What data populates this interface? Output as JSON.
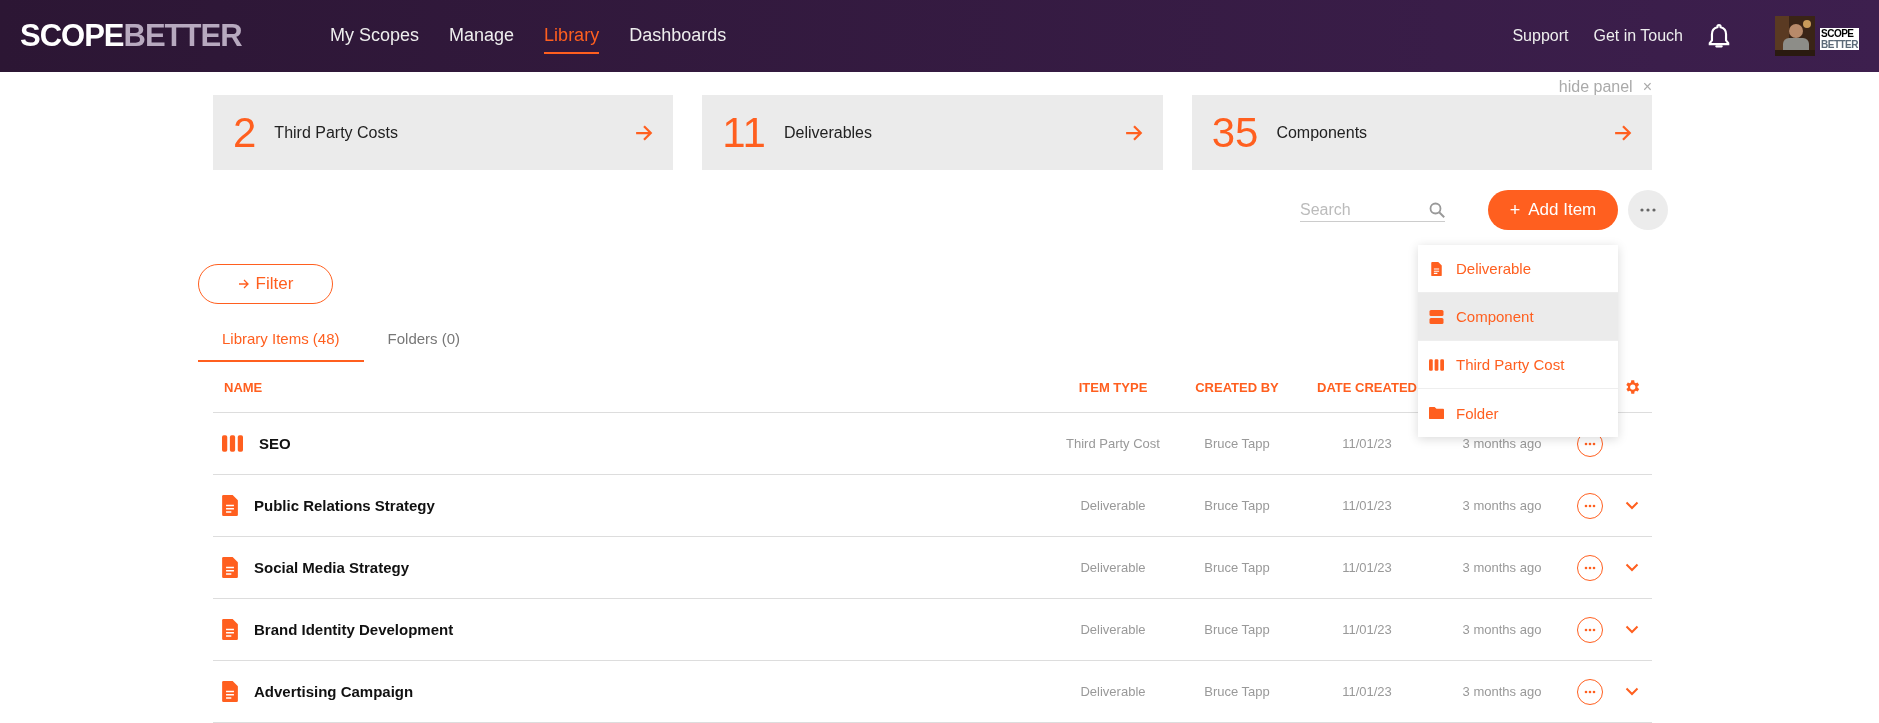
{
  "nav": {
    "logo": [
      "SCOPE",
      "BETTER"
    ],
    "links": [
      {
        "label": "My Scopes",
        "selected": false
      },
      {
        "label": "Manage",
        "selected": false
      },
      {
        "label": "Library",
        "selected": true
      },
      {
        "label": "Dashboards",
        "selected": false
      }
    ],
    "right_links": [
      "Support",
      "Get in Touch"
    ],
    "account_logo": [
      "SCOPE",
      "BETTER"
    ]
  },
  "panel": {
    "hide_label": "hide panel",
    "close": "×",
    "stats": [
      {
        "count": "2",
        "label": "Third Party Costs"
      },
      {
        "count": "11",
        "label": "Deliverables"
      },
      {
        "count": "35",
        "label": "Components"
      }
    ]
  },
  "search": {
    "placeholder": "Search"
  },
  "add_button": {
    "icon": "+",
    "label": "Add Item"
  },
  "add_menu": [
    {
      "kind": "deliverable",
      "label": "Deliverable",
      "selected": false
    },
    {
      "kind": "component",
      "label": "Component",
      "selected": true
    },
    {
      "kind": "third_party_cost",
      "label": "Third Party Cost",
      "selected": false
    },
    {
      "kind": "folder",
      "label": "Folder",
      "selected": false
    }
  ],
  "filter": {
    "label": "Filter"
  },
  "tabs": [
    {
      "label": "Library Items (48)",
      "selected": true
    },
    {
      "label": "Folders (0)",
      "selected": false
    }
  ],
  "table": {
    "columns": [
      "NAME",
      "ITEM TYPE",
      "CREATED BY",
      "DATE CREATED"
    ],
    "rows": [
      {
        "kind": "third_party_cost",
        "name": "SEO",
        "item_type": "Third Party Cost",
        "created_by": "Bruce Tapp",
        "date_created": "11/01/23",
        "column_5": "3 months ago",
        "expandable": false
      },
      {
        "kind": "deliverable",
        "name": "Public Relations Strategy",
        "item_type": "Deliverable",
        "created_by": "Bruce Tapp",
        "date_created": "11/01/23",
        "column_5": "3 months ago",
        "expandable": true
      },
      {
        "kind": "deliverable",
        "name": "Social Media Strategy",
        "item_type": "Deliverable",
        "created_by": "Bruce Tapp",
        "date_created": "11/01/23",
        "column_5": "3 months ago",
        "expandable": true
      },
      {
        "kind": "deliverable",
        "name": "Brand Identity Development",
        "item_type": "Deliverable",
        "created_by": "Bruce Tapp",
        "date_created": "11/01/23",
        "column_5": "3 months ago",
        "expandable": true
      },
      {
        "kind": "deliverable",
        "name": "Advertising Campaign",
        "item_type": "Deliverable",
        "created_by": "Bruce Tapp",
        "date_created": "11/01/23",
        "column_5": "3 months ago",
        "expandable": true
      }
    ]
  }
}
